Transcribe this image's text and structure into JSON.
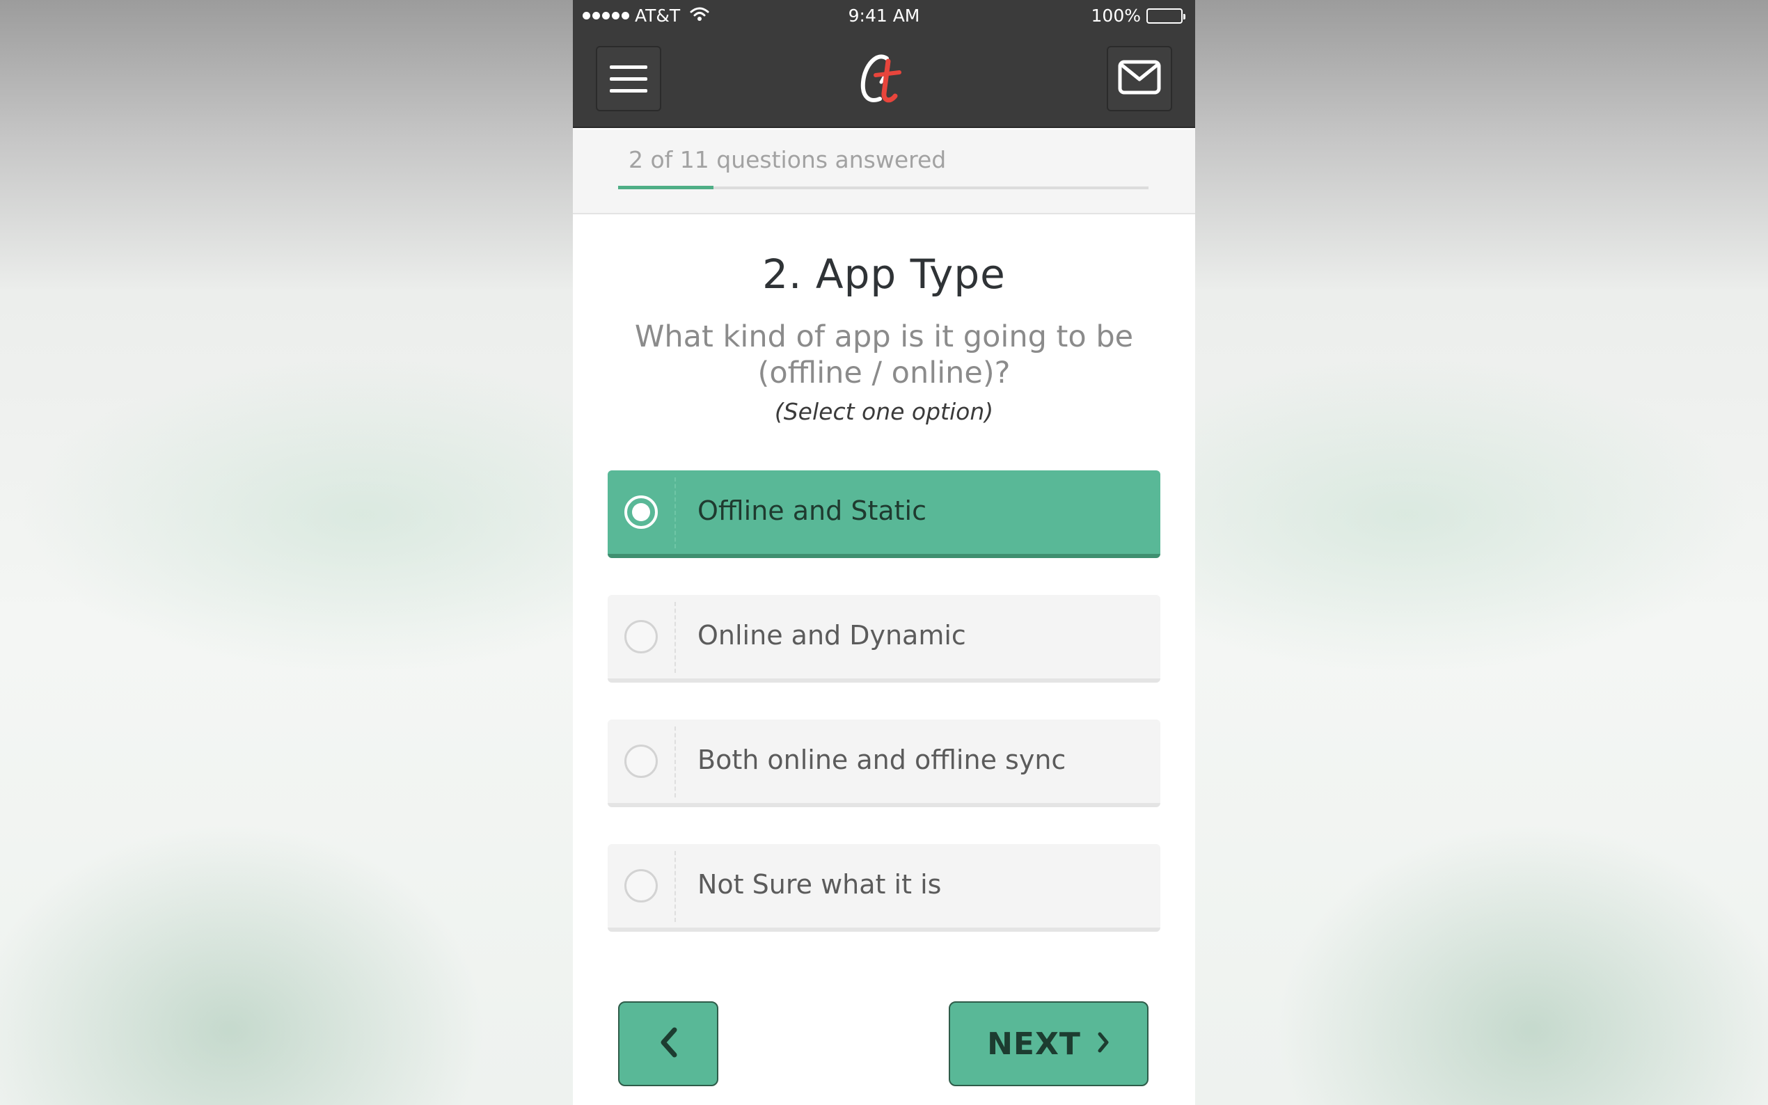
{
  "status_bar": {
    "carrier": "AT&T",
    "time": "9:41 AM",
    "battery_percent": "100%",
    "icons": [
      "signal-dots-icon",
      "wifi-icon",
      "battery-icon"
    ]
  },
  "navbar": {
    "menu_icon": "hamburger-menu-icon",
    "logo_icon": "brand-logo",
    "mail_icon": "envelope-icon"
  },
  "progress": {
    "text": "2 of 11 questions answered",
    "answered": 2,
    "total": 11,
    "fraction": 0.18,
    "color": "#4fae86"
  },
  "question": {
    "title": "2. App Type",
    "text": "What kind of app is it going to be (offline / online)?",
    "hint": "(Select one option)"
  },
  "options": [
    {
      "label": "Offline and Static",
      "selected": true
    },
    {
      "label": "Online and Dynamic",
      "selected": false
    },
    {
      "label": "Both online and offline sync",
      "selected": false
    },
    {
      "label": "Not Sure what it is",
      "selected": false
    }
  ],
  "navigation": {
    "back_icon": "chevron-left-icon",
    "next_label": "NEXT",
    "next_icon": "chevron-right-icon"
  },
  "colors": {
    "accent": "#59b897",
    "header": "#3b3b3b",
    "logo_red": "#e8453c"
  }
}
